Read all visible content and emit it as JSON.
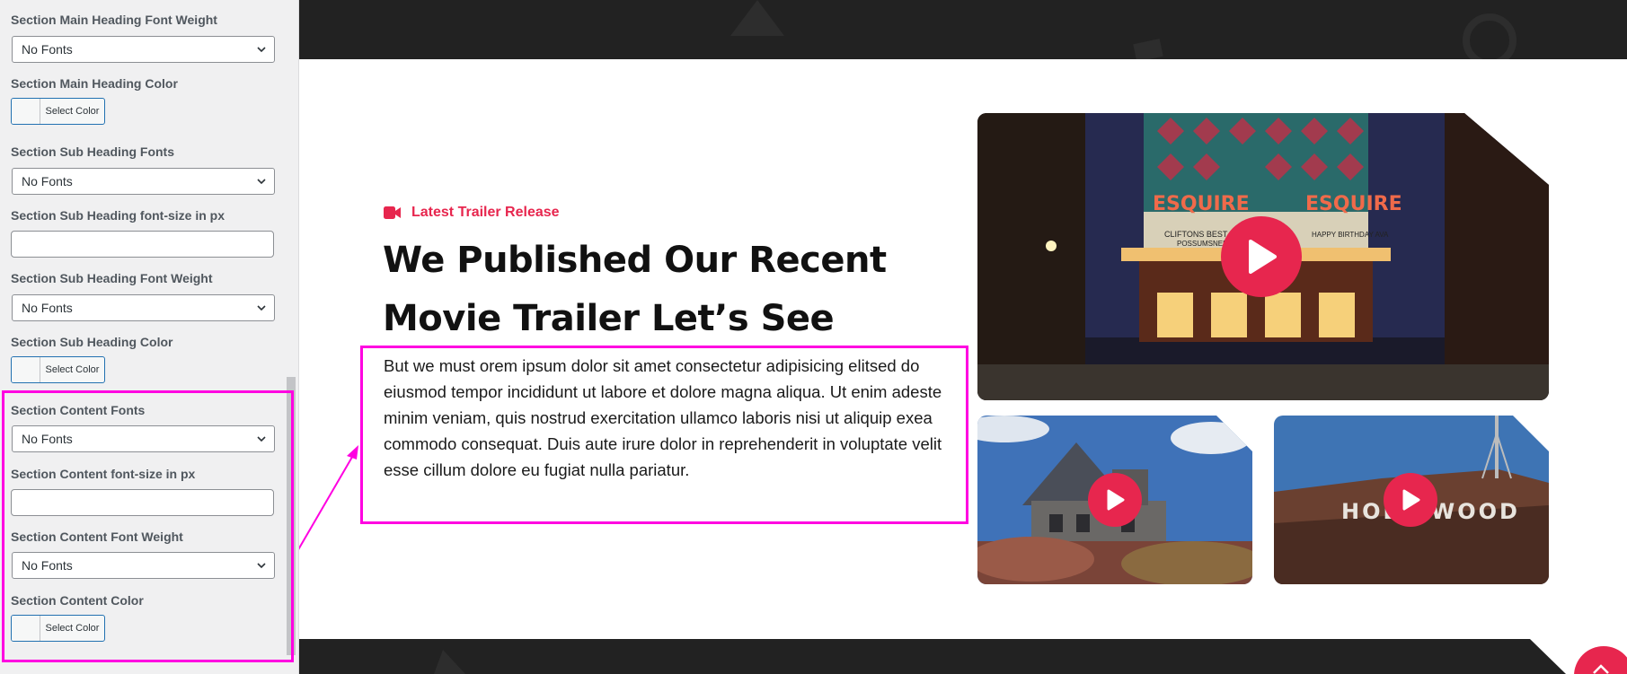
{
  "sidebar": {
    "main_heading_weight": {
      "label": "Section Main Heading Font Weight",
      "value": "No Fonts"
    },
    "main_heading_color": {
      "label": "Section Main Heading Color",
      "button": "Select Color"
    },
    "sub_heading_fonts": {
      "label": "Section Sub Heading Fonts",
      "value": "No Fonts"
    },
    "sub_heading_size": {
      "label": "Section Sub Heading font-size in px",
      "value": ""
    },
    "sub_heading_weight": {
      "label": "Section Sub Heading Font Weight",
      "value": "No Fonts"
    },
    "sub_heading_color": {
      "label": "Section Sub Heading Color",
      "button": "Select Color"
    },
    "content_fonts": {
      "label": "Section Content Fonts",
      "value": "No Fonts"
    },
    "content_size": {
      "label": "Section Content font-size in px",
      "value": ""
    },
    "content_weight": {
      "label": "Section Content Font Weight",
      "value": "No Fonts"
    },
    "content_color": {
      "label": "Section Content Color",
      "button": "Select Color"
    }
  },
  "preview": {
    "badge": {
      "icon": "video-camera-icon",
      "text": "Latest Trailer Release"
    },
    "heading_line1": "We Published Our Recent",
    "heading_line2": "Movie Trailer Let’s See",
    "content": "But we must orem ipsum dolor sit amet consectetur adipisicing elitsed do eiusmod tempor incididunt ut labore et dolore magna aliqua. Ut enim adeste minim veniam, quis nostrud exercitation ullamco laboris nisi ut aliquip exea commodo consequat. Duis aute irure dolor in reprehenderit in voluptate velit esse cillum dolore eu fugiat nulla pariatur.",
    "videos": [
      {
        "name": "theater-marquee",
        "marquee_left": "ESQUIRE",
        "marquee_right": "ESQUIRE",
        "sign_line1": "CLIFTONS BEST ARTIST",
        "sign_line2": "POSSUMSNEEZE",
        "sign_right": "HAPPY BIRTHDAY AVA"
      },
      {
        "name": "haunted-house"
      },
      {
        "name": "hollywood-sign",
        "sign_text": "HOLLYWOOD"
      }
    ]
  },
  "colors": {
    "accent": "#e7264e",
    "highlight": "#ff00e1",
    "dark_band": "#222222"
  }
}
